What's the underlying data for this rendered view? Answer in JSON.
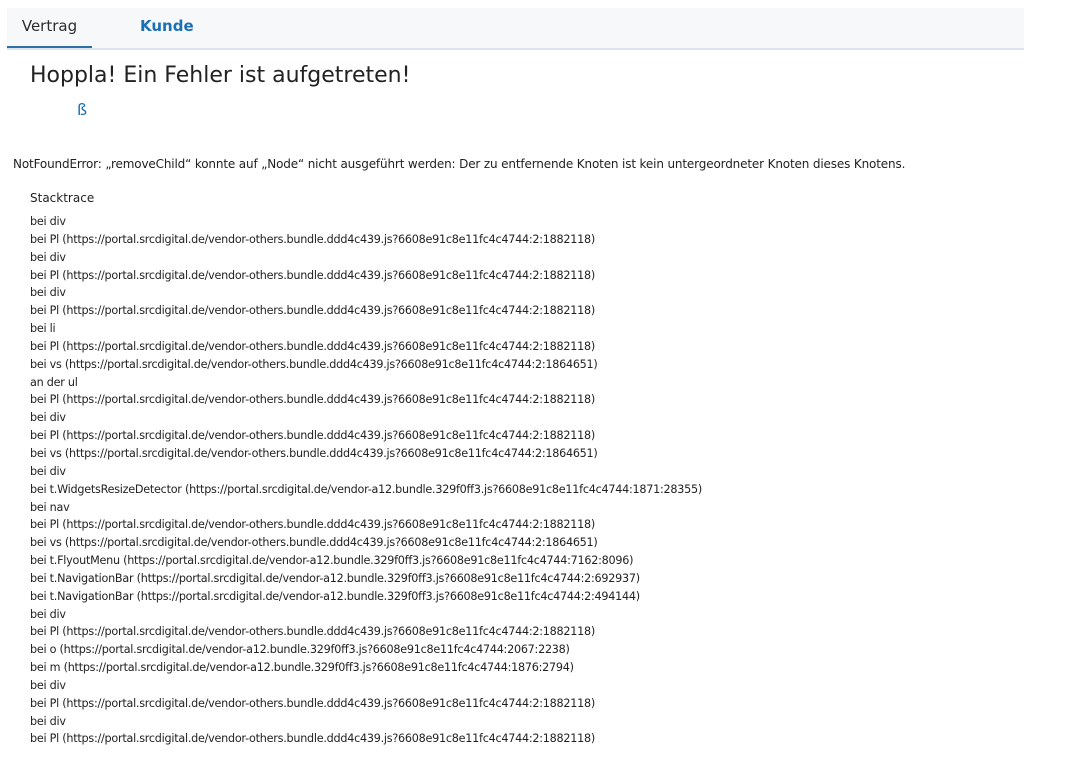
{
  "tabs": {
    "vertrag": "Vertrag",
    "kunde": "Kunde"
  },
  "error": {
    "title": "Hoppla! Ein Fehler ist aufgetreten!",
    "glyph": "ß",
    "message": "NotFoundError: „removeChild“ konnte auf „Node“ nicht ausgeführt werden: Der zu entfernende Knoten ist kein untergeordneter Knoten dieses Knotens.",
    "stacktrace_heading": "Stacktrace",
    "stacktrace": [
      "bei div",
      "bei Pl (https://portal.srcdigital.de/vendor-others.bundle.ddd4c439.js?6608e91c8e11fc4c4744:2:1882118)",
      "bei div",
      "bei Pl (https://portal.srcdigital.de/vendor-others.bundle.ddd4c439.js?6608e91c8e11fc4c4744:2:1882118)",
      "bei div",
      "bei Pl (https://portal.srcdigital.de/vendor-others.bundle.ddd4c439.js?6608e91c8e11fc4c4744:2:1882118)",
      "bei li",
      "bei Pl (https://portal.srcdigital.de/vendor-others.bundle.ddd4c439.js?6608e91c8e11fc4c4744:2:1882118)",
      "bei vs (https://portal.srcdigital.de/vendor-others.bundle.ddd4c439.js?6608e91c8e11fc4c4744:2:1864651)",
      "an der ul",
      "bei Pl (https://portal.srcdigital.de/vendor-others.bundle.ddd4c439.js?6608e91c8e11fc4c4744:2:1882118)",
      "bei div",
      "bei Pl (https://portal.srcdigital.de/vendor-others.bundle.ddd4c439.js?6608e91c8e11fc4c4744:2:1882118)",
      "bei vs (https://portal.srcdigital.de/vendor-others.bundle.ddd4c439.js?6608e91c8e11fc4c4744:2:1864651)",
      "bei div",
      "bei t.WidgetsResizeDetector (https://portal.srcdigital.de/vendor-a12.bundle.329f0ff3.js?6608e91c8e11fc4c4744:1871:28355)",
      "bei nav",
      "bei Pl (https://portal.srcdigital.de/vendor-others.bundle.ddd4c439.js?6608e91c8e11fc4c4744:2:1882118)",
      "bei vs (https://portal.srcdigital.de/vendor-others.bundle.ddd4c439.js?6608e91c8e11fc4c4744:2:1864651)",
      "bei t.FlyoutMenu (https://portal.srcdigital.de/vendor-a12.bundle.329f0ff3.js?6608e91c8e11fc4c4744:7162:8096)",
      "bei t.NavigationBar (https://portal.srcdigital.de/vendor-a12.bundle.329f0ff3.js?6608e91c8e11fc4c4744:2:692937)",
      "bei t.NavigationBar (https://portal.srcdigital.de/vendor-a12.bundle.329f0ff3.js?6608e91c8e11fc4c4744:2:494144)",
      "bei div",
      "bei Pl (https://portal.srcdigital.de/vendor-others.bundle.ddd4c439.js?6608e91c8e11fc4c4744:2:1882118)",
      "bei o (https://portal.srcdigital.de/vendor-a12.bundle.329f0ff3.js?6608e91c8e11fc4c4744:2067:2238)",
      "bei m (https://portal.srcdigital.de/vendor-a12.bundle.329f0ff3.js?6608e91c8e11fc4c4744:1876:2794)",
      "bei div",
      "bei Pl (https://portal.srcdigital.de/vendor-others.bundle.ddd4c439.js?6608e91c8e11fc4c4744:2:1882118)",
      "bei div",
      "bei Pl (https://portal.srcdigital.de/vendor-others.bundle.ddd4c439.js?6608e91c8e11fc4c4744:2:1882118)"
    ]
  },
  "colors": {
    "accent": "#1a6fb5",
    "tab_underline": "#2e6fa8",
    "tabbar_background": "#f6f8fa",
    "text": "#222222"
  }
}
